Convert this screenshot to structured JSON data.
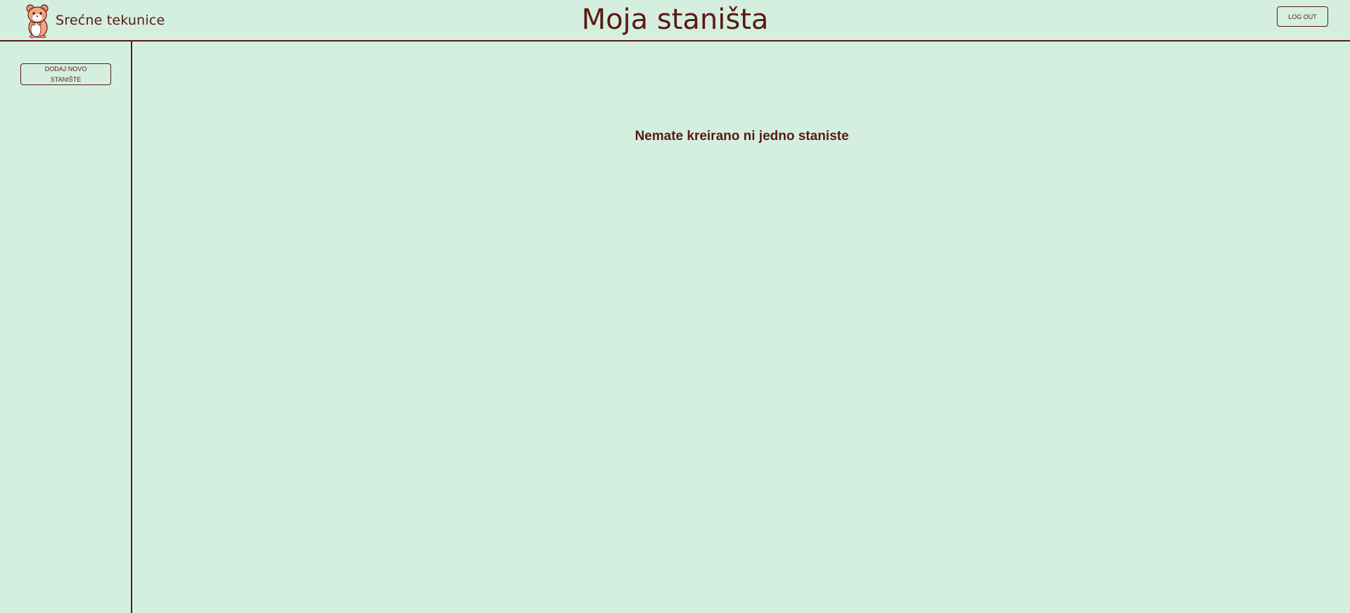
{
  "header": {
    "brand_name": "Srećne tekunice",
    "page_title": "Moja staništa",
    "logout_label": "LOG OUT",
    "logo_icon": "hamster-logo-icon"
  },
  "sidebar": {
    "add_button_label": "DODAJ NOVO STANIŠTE"
  },
  "main": {
    "empty_message": "Nemate kreirano ni jedno staniste"
  },
  "colors": {
    "background": "#d4efe0",
    "accent": "#5a1a12"
  }
}
